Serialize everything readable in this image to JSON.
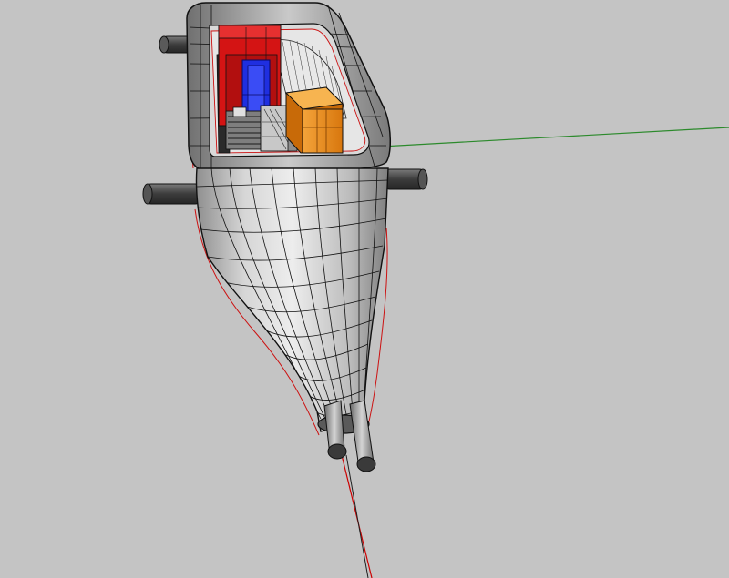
{
  "viewport": {
    "background_color": "#c4c4c4",
    "view_mode": "shaded-wireframe",
    "axis_colors": {
      "x": "#cc0000",
      "y": "#2c8a2c"
    }
  },
  "model": {
    "shell_color": "#b8b8b8",
    "edge_color": "#101010",
    "parts": [
      {
        "name": "hull-shell",
        "color": "#bdbdbd"
      },
      {
        "name": "red-box-component",
        "color": "#d41414"
      },
      {
        "name": "blue-component",
        "color": "#1f2fe0"
      },
      {
        "name": "orange-box-component",
        "color": "#f08a14"
      },
      {
        "name": "motor-component",
        "color": "#8a8a8a"
      },
      {
        "name": "twin-rod-nozzles",
        "color": "#a8a8a8"
      },
      {
        "name": "side-struts",
        "color": "#4a4a4a"
      }
    ]
  }
}
